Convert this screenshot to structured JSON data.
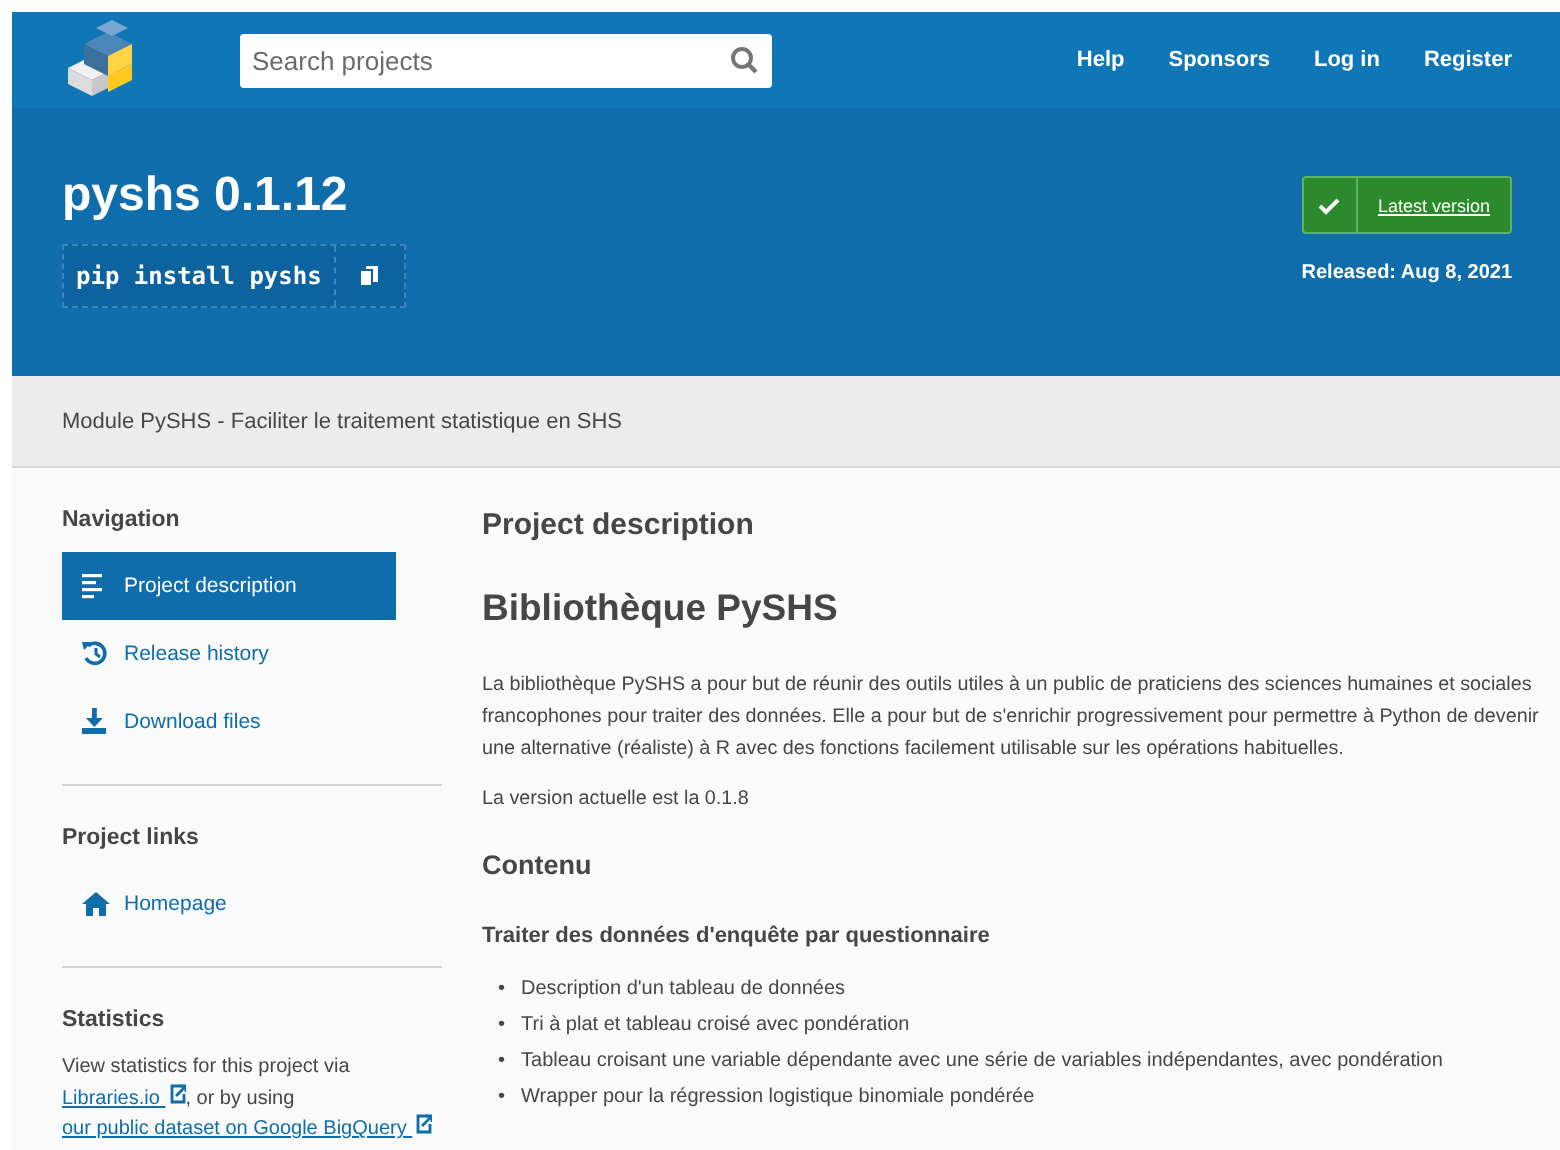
{
  "header": {
    "search": {
      "placeholder": "Search projects"
    },
    "nav_links": [
      "Help",
      "Sponsors",
      "Log in",
      "Register"
    ]
  },
  "package": {
    "title": "pyshs 0.1.12",
    "pip_command": "pip install pyshs",
    "latest_button": "Latest version",
    "released": "Released: Aug 8, 2021"
  },
  "summary": "Module PySHS - Faciliter le traitement statistique en SHS",
  "sidebar": {
    "sections": [
      {
        "heading": "Navigation",
        "items": [
          {
            "label": "Project description",
            "kind": "description",
            "selected": true
          },
          {
            "label": "Release history",
            "kind": "history",
            "selected": false
          },
          {
            "label": "Download files",
            "kind": "download",
            "selected": false
          }
        ]
      },
      {
        "heading": "Project links",
        "items": [
          {
            "label": "Homepage",
            "kind": "homepage",
            "selected": false
          }
        ]
      },
      {
        "heading": "Statistics",
        "text": [
          {
            "kind": "text",
            "text": "View statistics for this project via "
          },
          {
            "kind": "link",
            "text": "Libraries.io"
          },
          {
            "kind": "text",
            "text": ", or by using "
          },
          {
            "kind": "link",
            "text": "our public dataset on Google BigQuery"
          }
        ]
      }
    ]
  },
  "content": {
    "heading": "Project description",
    "title": "Bibliothèque PySHS",
    "paragraphs": [
      "La bibliothèque PySHS a pour but de réunir des outils utiles à un public de praticiens des sciences humaines et sociales francophones pour traiter des données. Elle a pour but de s'enrichir progressivement pour permettre à Python de devenir une alternative (réaliste) à R avec des fonctions facilement utilisable sur les opérations habituelles.",
      "La version actuelle est la 0.1.8"
    ],
    "section_heading": "Contenu",
    "subsection_heading": "Traiter des données d'enquête par questionnaire",
    "bullets": [
      {
        "marker": "•",
        "text": "Description d'un tableau de données"
      },
      {
        "marker": "•",
        "text": "Tri à plat et tableau croisé avec pondération"
      },
      {
        "marker": "•",
        "text": "Tableau croisant une variable dépendante avec une série de variables indépendantes, avec pondération"
      },
      {
        "marker": "•",
        "text": "Wrapper pour la régression logistique binomiale pondérée"
      }
    ]
  }
}
